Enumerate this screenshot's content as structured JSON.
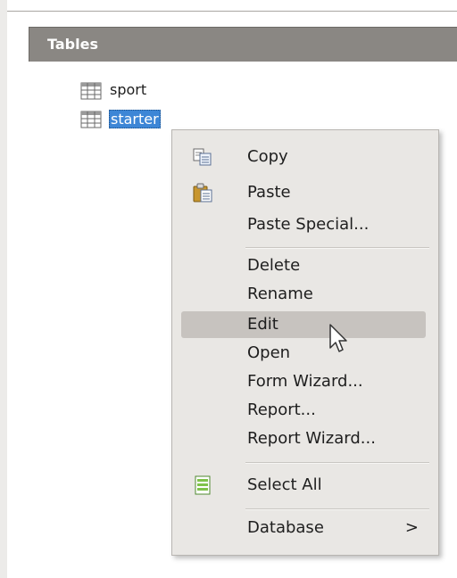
{
  "section": {
    "title": "Tables"
  },
  "tables": [
    {
      "name": "sport",
      "selected": false
    },
    {
      "name": "starter",
      "selected": true
    }
  ],
  "context_menu": {
    "items": [
      {
        "label": "Copy",
        "icon": "copy-icon"
      },
      {
        "label": "Paste",
        "icon": "paste-icon"
      },
      {
        "label": "Paste Special..."
      },
      {
        "label": "Delete"
      },
      {
        "label": "Rename"
      },
      {
        "label": "Edit",
        "highlighted": true
      },
      {
        "label": "Open"
      },
      {
        "label": "Form Wizard..."
      },
      {
        "label": "Report..."
      },
      {
        "label": "Report Wizard..."
      },
      {
        "label": "Select All",
        "icon": "select-all-icon"
      },
      {
        "label": "Database",
        "submenu_arrow": ">"
      }
    ]
  },
  "colors": {
    "header_bg": "#8a8783",
    "selection": "#3d86d6",
    "menu_bg": "#e9e7e4",
    "menu_hover": "#c7c3bf"
  }
}
